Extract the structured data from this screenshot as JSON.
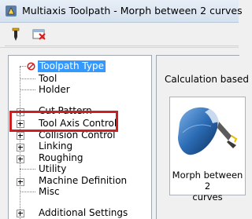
{
  "window": {
    "title": "Multiaxis Toolpath - Morph between 2 curves",
    "app_icon": "multiaxis-app-icon"
  },
  "toolbar": {
    "buttons": [
      {
        "icon": "tool-pin-icon"
      },
      {
        "icon": "delete-operation-icon"
      }
    ]
  },
  "tree": {
    "items": [
      {
        "label": "Toolpath Type",
        "selected": true,
        "icon": "invalid-circle-icon"
      },
      {
        "label": "Tool"
      },
      {
        "label": "Holder"
      },
      {
        "label": "Cut Pattern",
        "expandable": true
      },
      {
        "label": "Tool Axis Control",
        "expandable": true,
        "highlighted": true
      },
      {
        "label": "Collision Control",
        "expandable": true
      },
      {
        "label": "Linking",
        "expandable": true
      },
      {
        "label": "Roughing",
        "expandable": true
      },
      {
        "label": "Utility"
      },
      {
        "label": "Machine Definition",
        "expandable": true
      },
      {
        "label": "Misc"
      },
      {
        "label": "Additional Settings",
        "expandable": true
      }
    ]
  },
  "right_panel": {
    "heading": "Calculation based",
    "preview": {
      "caption_line1": "Morph between 2",
      "caption_line2": "curves"
    }
  },
  "colors": {
    "selection": "#3399ff",
    "highlight_box": "#cc1f1f",
    "tool_blue": "#2b6cb5"
  }
}
